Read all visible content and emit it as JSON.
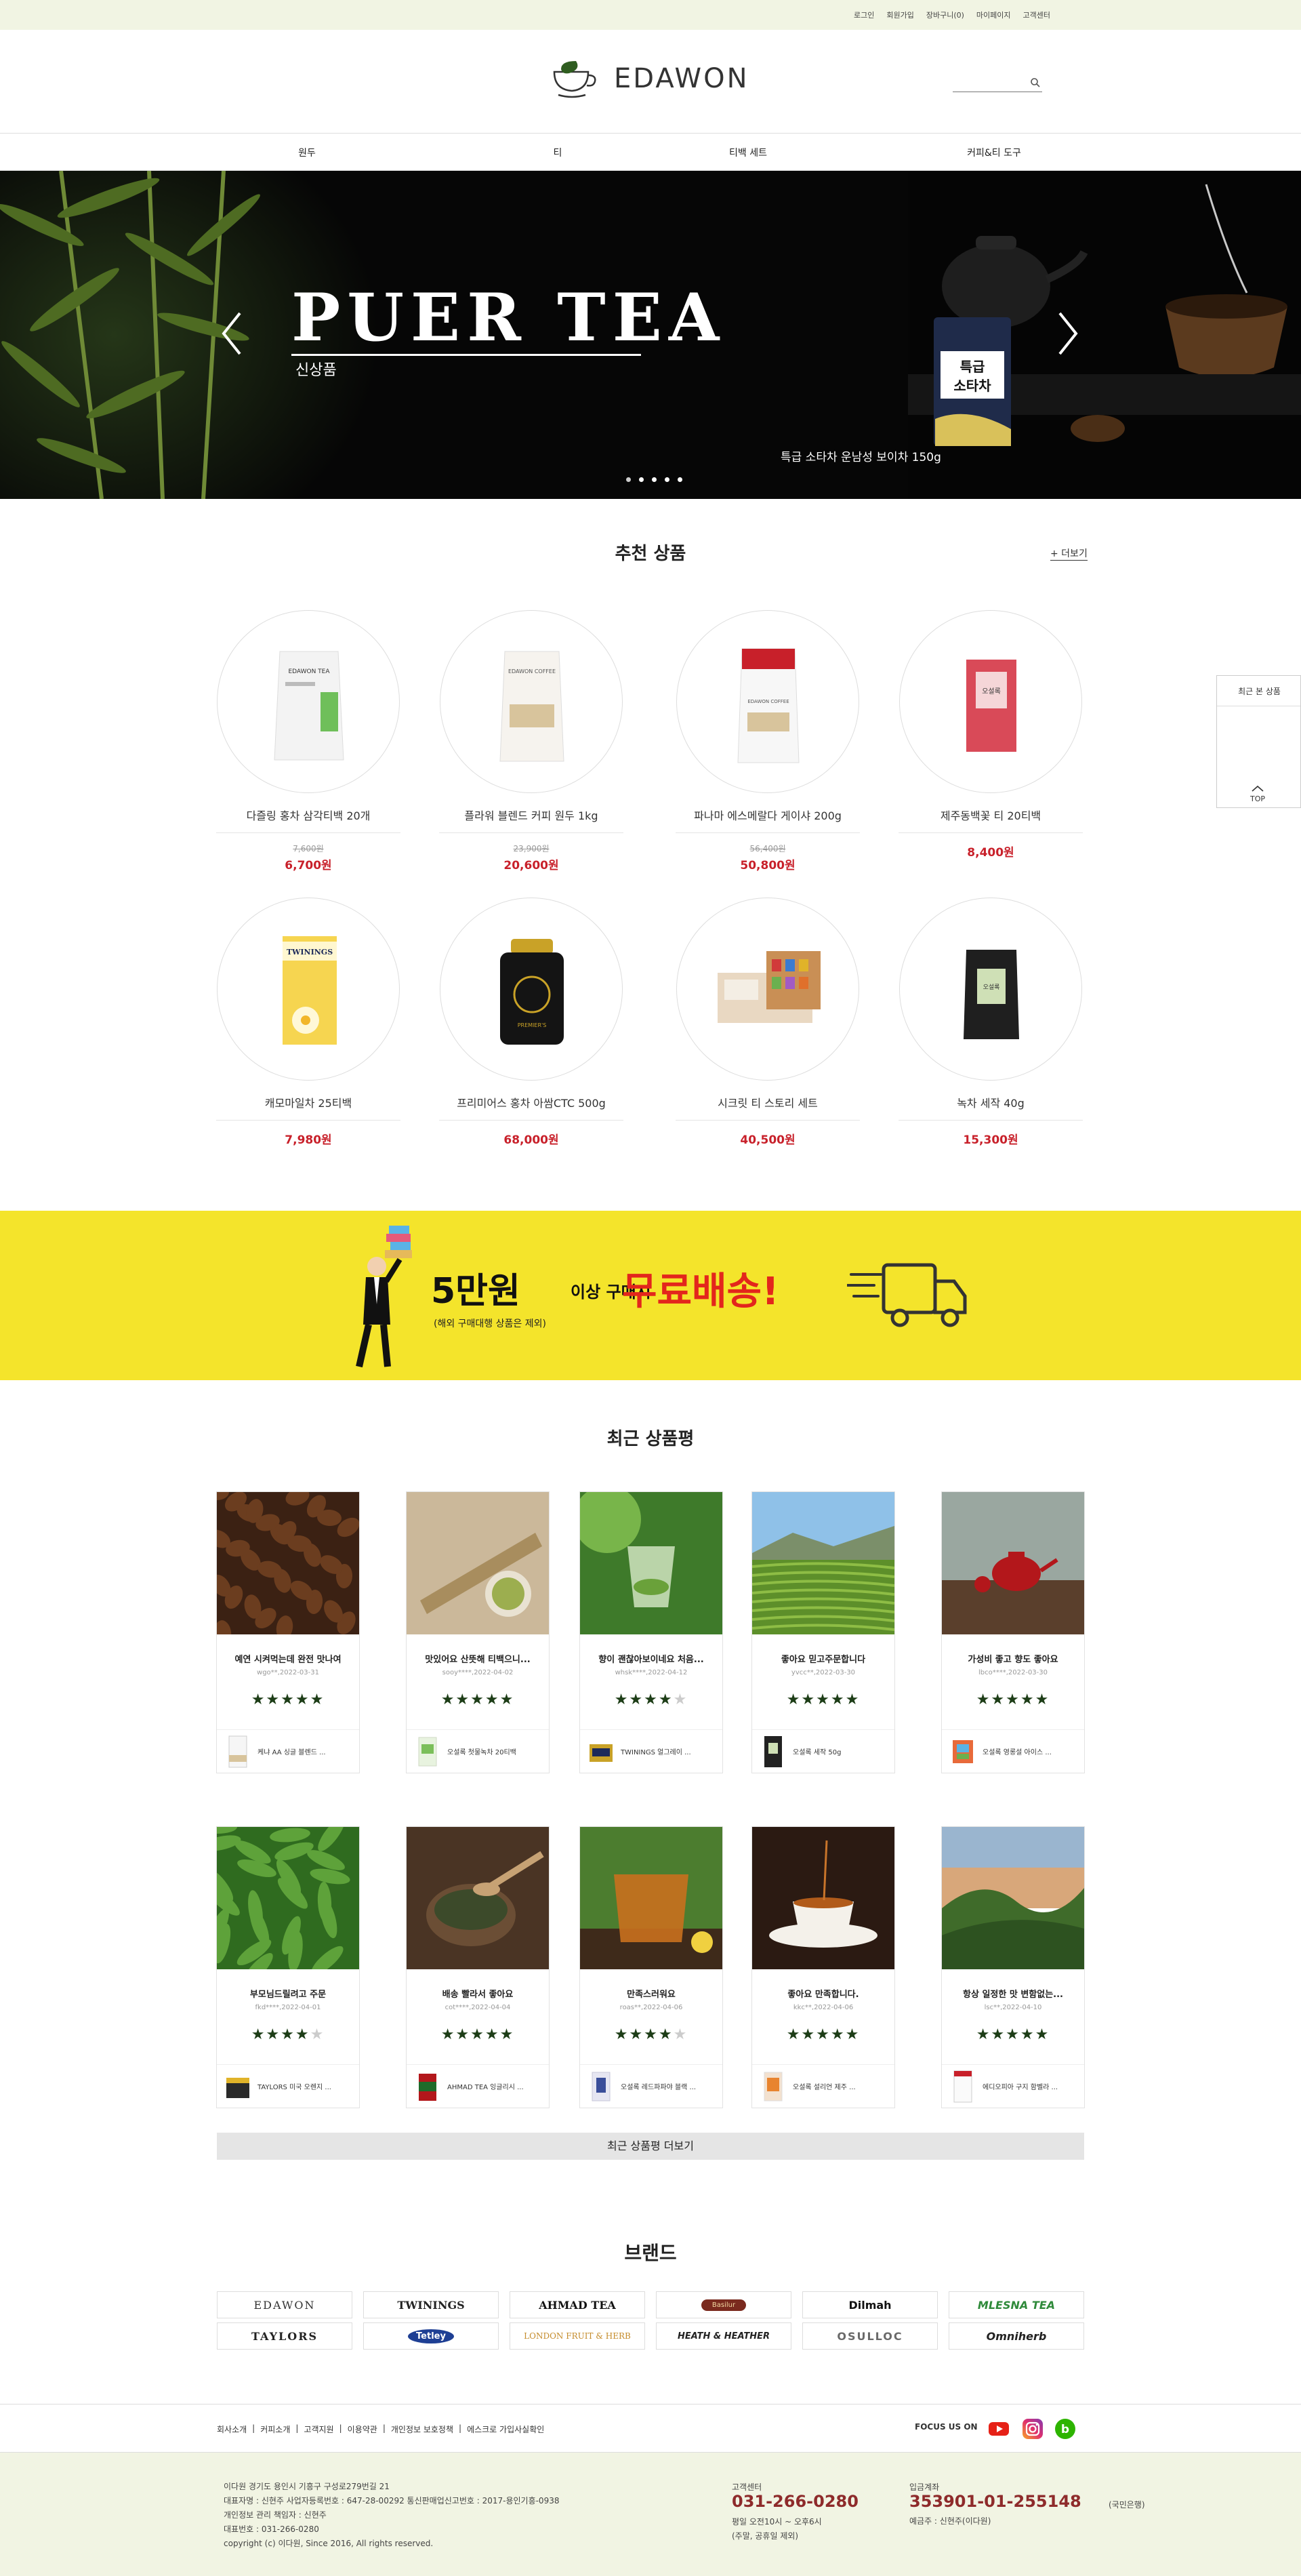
{
  "top_links": [
    "로그인",
    "회원가입",
    "장바구니(0)",
    "마이페이지",
    "고객센터"
  ],
  "brand": {
    "name": "EDAWON"
  },
  "search": {
    "placeholder": ""
  },
  "nav": [
    "원두",
    "티",
    "티백 세트",
    "커피&티 도구"
  ],
  "banner": {
    "title": "PUER TEA",
    "subtitle": "신상품",
    "caption": "특급 소타차 운남성 보이차 150g",
    "package_text": "특급\n소타차",
    "slides": 5,
    "active_slide": 0
  },
  "recommended": {
    "title": "추천 상품",
    "more": "+ 더보기",
    "products": [
      {
        "name": "다즐링 홍차 삼각티백 20개",
        "old_price": "7,600원",
        "price": "6,700원",
        "image": "white-tea-bag",
        "label": "EDAWON TEA"
      },
      {
        "name": "플라워 블렌드 커피 원두 1kg",
        "old_price": "23,900원",
        "price": "20,600원",
        "image": "white-coffee-bag",
        "label": "EDAWON COFFEE"
      },
      {
        "name": "파나마 에스메랄다 게이샤 200g",
        "old_price": "56,400원",
        "price": "50,800원",
        "image": "white-red-bag",
        "label": "EDAWON COFFEE"
      },
      {
        "name": "제주동백꽃 티 20티백",
        "old_price": "",
        "price": "8,400원",
        "image": "red-box",
        "label": "오설록"
      },
      {
        "name": "캐모마일차 25티백",
        "old_price": "",
        "price": "7,980원",
        "image": "yellow-box",
        "label": "TWININGS"
      },
      {
        "name": "프리미어스 홍차 아쌈CTC 500g",
        "old_price": "",
        "price": "68,000원",
        "image": "black-gold-tin",
        "label": "PREMIER'S"
      },
      {
        "name": "시크릿 티 스토리 세트",
        "old_price": "",
        "price": "40,500원",
        "image": "gift-set",
        "label": ""
      },
      {
        "name": "녹차 세작 40g",
        "old_price": "",
        "price": "15,300원",
        "image": "black-pouch",
        "label": "오설록"
      }
    ]
  },
  "side_widget": {
    "title": "최근 본 상품",
    "top_label": "TOP"
  },
  "promo": {
    "amount": "5만원",
    "middle": "이상 구매시",
    "highlight": "무료배송!",
    "note": "(해외 구매대행 상품은 제외)"
  },
  "reviews": {
    "title": "최근 상품평",
    "more": "최근 상품평 더보기",
    "items": [
      {
        "title": "예연 시켜먹는데 완전 맛나여",
        "meta": "wgo**,2022-03-31",
        "stars": 5,
        "image": "coffee-beans",
        "product": "케냐 AA 싱글 블렌드 ...",
        "thumb": "white-pouch"
      },
      {
        "title": "맛있어요 산뜻해 티백으니...",
        "meta": "sooy****,2022-04-02",
        "stars": 5,
        "image": "tea-scoop",
        "product": "오설록 첫물녹차 20티백",
        "thumb": "green-box"
      },
      {
        "title": "향이 괜찮아보이네요 처음...",
        "meta": "whsk****,2022-04-12",
        "stars": 4,
        "image": "green-tea-glass",
        "product": "TWININGS 얼그레이 ...",
        "thumb": "yellow-tin"
      },
      {
        "title": "좋아요 믿고주문합니다",
        "meta": "yvcc**,2022-03-30",
        "stars": 5,
        "image": "tea-field",
        "product": "오설록 세작 50g",
        "thumb": "dark-pouch"
      },
      {
        "title": "가성비 좋고 향도 좋아요",
        "meta": "lbco****,2022-03-30",
        "stars": 5,
        "image": "red-teapot",
        "product": "오설록 영롱설 아이스 ...",
        "thumb": "colorful-box"
      },
      {
        "title": "부모님드릴려고 주문",
        "meta": "fkd****,2022-04-01",
        "stars": 4,
        "image": "tea-leaves",
        "product": "TAYLORS 미국 오렌지 ...",
        "thumb": "dark-yellow-box"
      },
      {
        "title": "배송 빨라서 좋아요",
        "meta": "cot****,2022-04-04",
        "stars": 5,
        "image": "tea-spoon-bowl",
        "product": "AHMAD TEA 잉글리시 ...",
        "thumb": "red-green-tin"
      },
      {
        "title": "만족스러워요",
        "meta": "roas**,2022-04-06",
        "stars": 4,
        "image": "tea-cup-glass",
        "product": "오설록 레드파파야 블랙 ...",
        "thumb": "blue-box"
      },
      {
        "title": "좋아요 만족합니다.",
        "meta": "kkc**,2022-04-06",
        "stars": 5,
        "image": "pouring-tea",
        "product": "오설록 설리언 제주 ...",
        "thumb": "orange-pouch"
      },
      {
        "title": "항상 일정한 맛 변함없는...",
        "meta": "lsc**,2022-04-10",
        "stars": 5,
        "image": "tea-hills-sunset",
        "product": "에디오피아 구지 함벨라 ...",
        "thumb": "white-bag-red"
      }
    ]
  },
  "brands": {
    "title": "브랜드",
    "items": [
      "EDAWON",
      "TWININGS",
      "AHMAD TEA",
      "Basilur",
      "Dilmah",
      "MLESNA TEA",
      "TAYLORS",
      "Tetley",
      "LONDON FRUIT & HERB",
      "HEATH & HEATHER",
      "OSULLOC",
      "Omniherb"
    ]
  },
  "footer": {
    "links": [
      "회사소개",
      "커피소개",
      "고객지원",
      "이용약관",
      "개인정보 보호정책",
      "에스크로 가입사실확인"
    ],
    "focus": "FOCUS US ON",
    "company_lines": [
      "이다원 경기도 용인시 기흥구 구성로279번길 21",
      "대표자명 : 신현주 사업자등록번호 : 647-28-00292    통신판매업신고번호 : 2017-용인기흥-0938",
      "개인정보 관리 책임자 : 신현주",
      "대표번호 : 031-266-0280",
      "copyright (c) 이다원, Since 2016, All rights reserved."
    ],
    "cs_label": "고객센터",
    "cs_phone": "031-266-0280",
    "cs_hours": [
      "평일 오전10시 ~ 오후6시",
      "(주말, 공휴일 제외)"
    ],
    "bank_label": "입금계좌",
    "bank_account": "353901-01-255148",
    "bank_name": "(국민은행)",
    "bank_holder": "예금주 : 신현주(이다원)"
  }
}
